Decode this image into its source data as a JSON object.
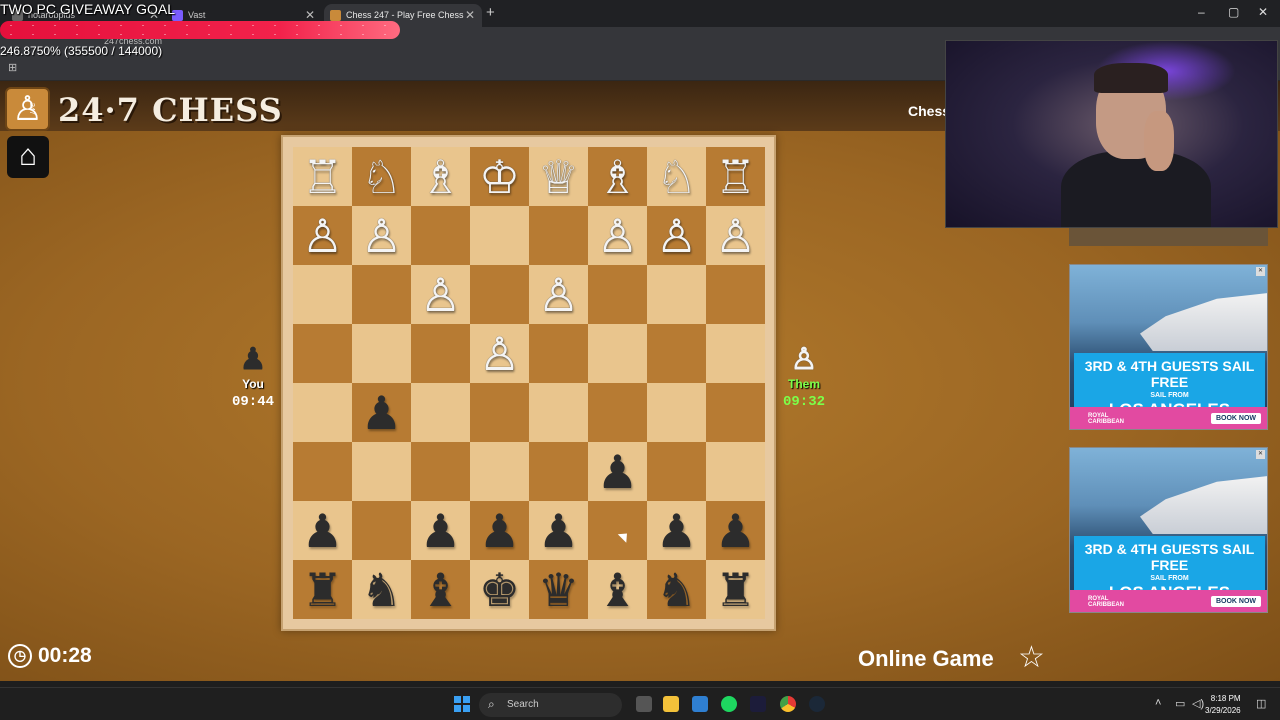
{
  "browser": {
    "tabs": [
      {
        "label": "notarobpius",
        "active": false
      },
      {
        "label": "Vast",
        "active": false
      },
      {
        "label": "Chess 247 - Play Free Chess",
        "active": true
      }
    ],
    "new_tab": "+",
    "url": "247chess.com",
    "window_controls": {
      "minimize": "–",
      "maximize": "▢",
      "close": "✕"
    }
  },
  "stream": {
    "giveaway_title": "TWO PC GIVEAWAY GOAL",
    "goal_progress_text": "246.8750% (355500 / 144000)"
  },
  "site": {
    "logo_text": "24·7 CHESS",
    "logo_small": "247",
    "nav_link": "Chess"
  },
  "game": {
    "you_label": "You",
    "you_time": "09:44",
    "them_label": "Them",
    "them_time": "09:32",
    "elapsed": "00:28",
    "mode": "Online Game",
    "board_rows": [
      [
        "♖",
        "♘",
        "♗",
        "♔",
        "♕",
        "♗",
        "♘",
        "♖"
      ],
      [
        "♙",
        "♙",
        "",
        "",
        "",
        "♙",
        "♙",
        "♙"
      ],
      [
        "",
        "",
        "♙",
        "",
        "♙",
        "",
        "",
        ""
      ],
      [
        "",
        "",
        "",
        "♙",
        "",
        "",
        "",
        ""
      ],
      [
        "",
        "♟",
        "",
        "",
        "",
        "",
        "",
        ""
      ],
      [
        "",
        "",
        "",
        "",
        "",
        "♟",
        "",
        ""
      ],
      [
        "♟",
        "",
        "♟",
        "♟",
        "♟",
        "",
        "♟",
        "♟"
      ],
      [
        "♜",
        "♞",
        "♝",
        "♚",
        "♛",
        "♝",
        "♞",
        "♜"
      ]
    ],
    "board_colors": [
      "white",
      "black"
    ]
  },
  "ads": [
    {
      "headline": "3RD & 4TH GUESTS SAIL FREE",
      "sub": "SAIL FROM",
      "place": "LOS ANGELES",
      "brand": "ROYAL CARIBBEAN",
      "cta": "BOOK NOW"
    },
    {
      "headline": "3RD & 4TH GUESTS SAIL FREE",
      "sub": "SAIL FROM",
      "place": "LOS ANGELES",
      "brand": "ROYAL CARIBBEAN",
      "cta": "BOOK NOW"
    }
  ],
  "taskbar": {
    "search_placeholder": "Search",
    "time": "8:18 PM",
    "date": "3/29/2026"
  }
}
